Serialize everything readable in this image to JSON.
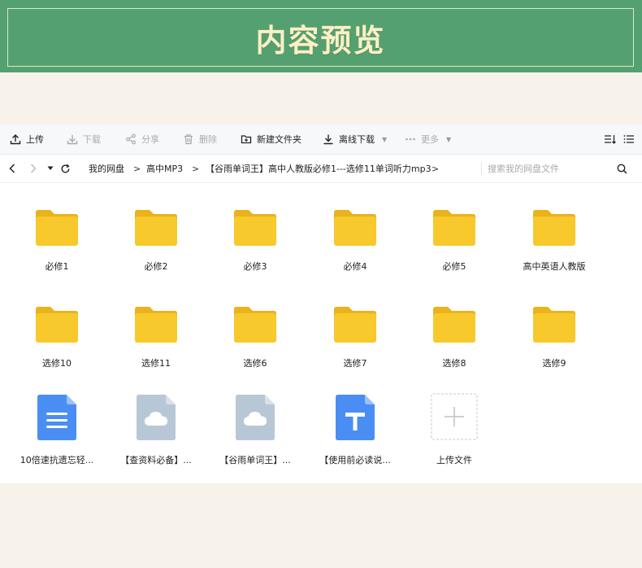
{
  "banner": {
    "title": "内容预览"
  },
  "toolbar": {
    "upload": "上传",
    "download": "下载",
    "share": "分享",
    "delete": "删除",
    "new_folder": "新建文件夹",
    "offline_download": "离线下载",
    "more": "更多"
  },
  "navbar": {
    "breadcrumbs": [
      "我的网盘",
      "高中MP3",
      "【谷雨单词王】高中人教版必修1---选修11单词听力mp3"
    ],
    "separator": ">",
    "search_placeholder": "搜索我的网盘文件"
  },
  "files": [
    {
      "name": "必修1",
      "type": "folder"
    },
    {
      "name": "必修2",
      "type": "folder"
    },
    {
      "name": "必修3",
      "type": "folder"
    },
    {
      "name": "必修4",
      "type": "folder"
    },
    {
      "name": "必修5",
      "type": "folder"
    },
    {
      "name": "高中英语人教版",
      "type": "folder"
    },
    {
      "name": "选修10",
      "type": "folder"
    },
    {
      "name": "选修11",
      "type": "folder"
    },
    {
      "name": "选修6",
      "type": "folder"
    },
    {
      "name": "选修7",
      "type": "folder"
    },
    {
      "name": "选修8",
      "type": "folder"
    },
    {
      "name": "选修9",
      "type": "folder"
    },
    {
      "name": "10倍速抗遗忘轻...",
      "type": "doc"
    },
    {
      "name": "【查资料必备】...",
      "type": "cloud"
    },
    {
      "name": "【谷雨单词王】...",
      "type": "cloud"
    },
    {
      "name": "【使用前必读说...",
      "type": "text"
    }
  ],
  "upload_tile": {
    "label": "上传文件"
  },
  "colors": {
    "banner_bg": "#55a070",
    "banner_title": "#fbf0c4",
    "folder": "#f8c92c",
    "folder_tab": "#e9b31c",
    "doc_blue": "#4a8ef3",
    "cloud_gray": "#b8c7d6",
    "page_bg": "#f7f3ea"
  }
}
